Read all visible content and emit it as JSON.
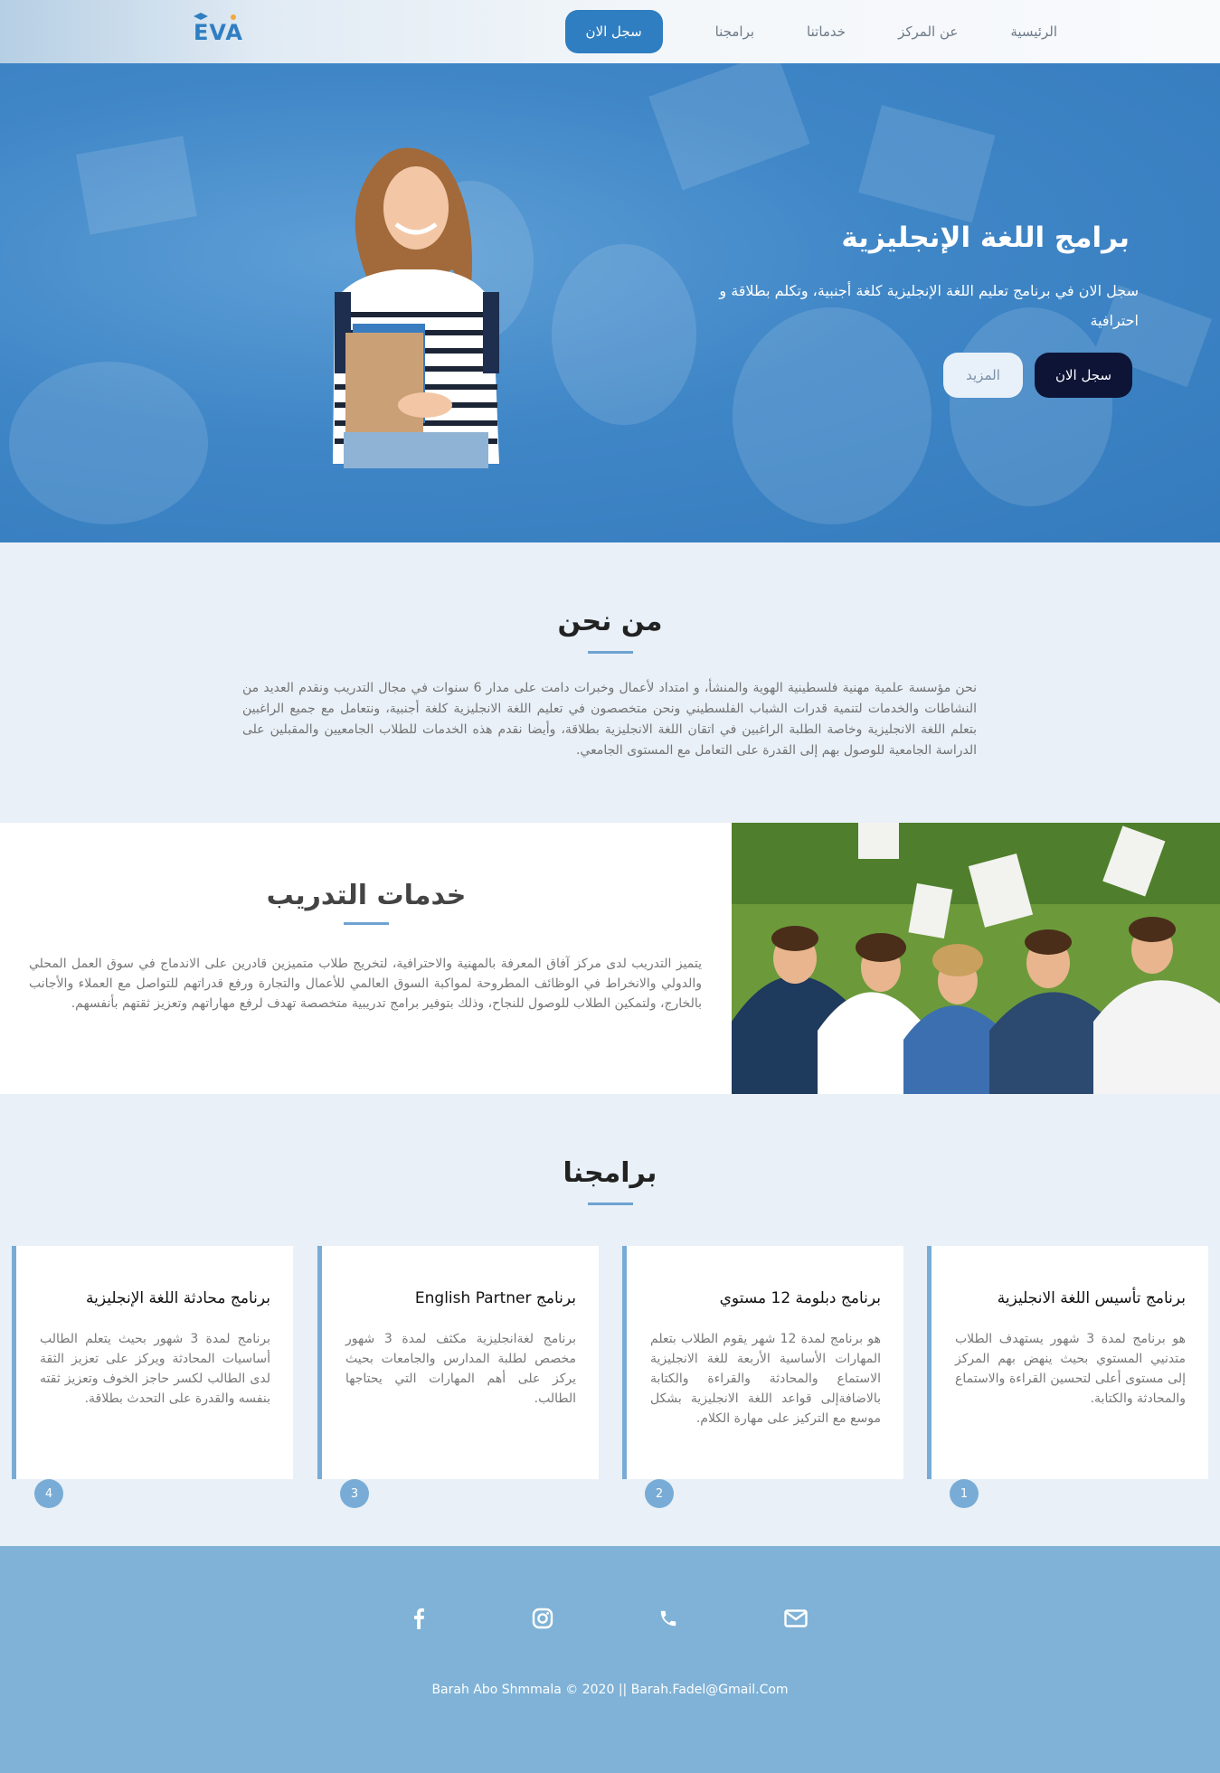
{
  "nav": {
    "logo_text": "EVA",
    "links": [
      "الرئيسية",
      "عن المركز",
      "خدماتنا",
      "برامجنا"
    ],
    "cta": "سجل الان"
  },
  "hero": {
    "title": "برامج اللغة الإنجليزية",
    "subtitle": "سجل الان في برنامج تعليم اللغة الإنجليزية كلغة أجنبية، وتكلم بطلاقة و احترافية",
    "primary_button": "سجل الان",
    "secondary_button": "المزيد"
  },
  "about": {
    "title": "من نحن",
    "text": "نحن مؤسسة علمية مهنية فلسطينية الهوية والمنشأ، و امتداد لأعمال وخبرات دامت على مدار 6 سنوات في مجال التدريب ونقدم العديد من النشاطات والخدمات لتنمية قدرات الشباب الفلسطيني ونحن متخصصون في تعليم اللغة الانجليزية كلغة أجنبية، ونتعامل مع جميع الراغبين بتعلم اللغة الانجليزية وخاصة الطلبة الراغبين في اتقان اللغة الانجليزية بطلاقة، وأيضا نقدم هذه الخدمات للطلاب الجامعيين والمقبلين على الدراسة الجامعية للوصول بهم إلى القدرة على التعامل مع المستوى الجامعي."
  },
  "training": {
    "title": "خدمات التدريب",
    "text": "يتميز التدريب لدى مركز آفاق المعرفة بالمهنية والاحترافية، لتخريج طلاب متميزين قادرين على الاندماج في سوق العمل المحلي والدولي والانخراط في الوظائف المطروحة لمواكبة السوق العالمي للأعمال والتجارة ورفع قدراتهم للتواصل مع العملاء والأجانب بالخارج، ولتمكين الطلاب للوصول للنجاح، وذلك بتوفير برامج تدريبية متخصصة تهدف لرفع مهاراتهم وتعزيز ثقتهم بأنفسهم."
  },
  "programs": {
    "title": "برامجنا",
    "cards": [
      {
        "num": "1",
        "title": "برنامج تأسيس اللغة الانجليزية",
        "text": "هو برنامج لمدة 3 شهور يستهدف الطلاب متدنيي المستوي بحيث ينهض بهم المركز إلى مستوى أعلى لتحسين القراءة والاستماع والمحادثة والكتابة."
      },
      {
        "num": "2",
        "title": "برنامج دبلومة 12 مستوي",
        "text": "هو برنامج لمدة 12 شهر يقوم الطلاب بتعلم المهارات الأساسية الأربعة للغة الانجليزية الاستماع والمحادثة والقراءة والكتابة بالاضافةإلى قواعد اللغة الانجليزية بشكل موسع مع التركيز على مهارة الكلام."
      },
      {
        "num": "3",
        "title": "برنامج English Partner",
        "text": "برنامج لغةانجليزية مكثف لمدة 3 شهور مخصص لطلبة المدارس والجامعات بحيث يركز على أهم المهارات التي يحتاجها الطالب."
      },
      {
        "num": "4",
        "title": "برنامج محادثة اللغة الإنجليزية",
        "text": "برنامج لمدة 3 شهور بحيث يتعلم الطالب أساسيات المحادثة ويركز على تعزيز الثقة لدى الطالب لكسر حاجز الخوف وتعزيز ثقته بنفسه والقدرة على التحدث بطلاقة."
      }
    ]
  },
  "footer": {
    "icons": [
      "facebook-icon",
      "instagram-icon",
      "phone-icon",
      "mail-icon"
    ],
    "copyright": "Barah Abo Shmmala © 2020 || Barah.Fadel@Gmail.Com"
  },
  "colors": {
    "accent": "#2f7ec1",
    "dark_button": "#0d1436",
    "hero_blue": "#3f86c7",
    "footer": "#7fb2d6",
    "line": "#6fa3d2"
  }
}
